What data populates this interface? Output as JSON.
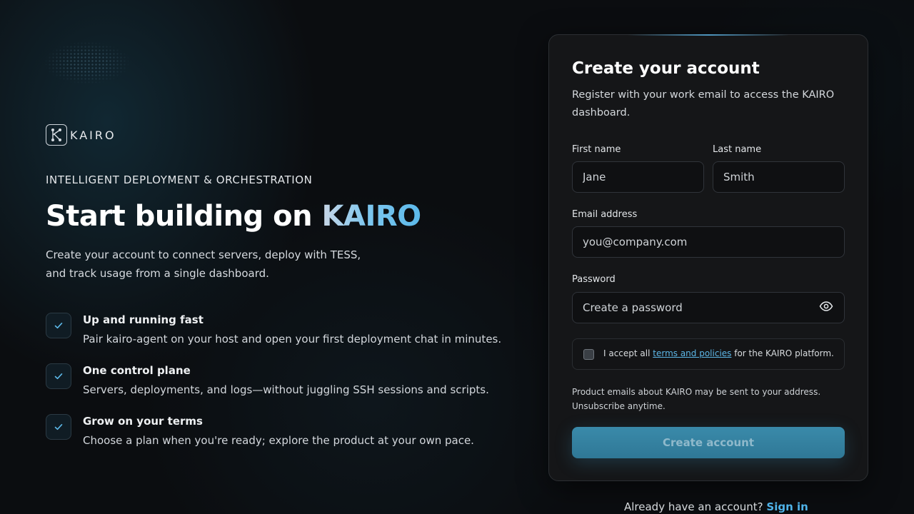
{
  "brand": {
    "name": "KAIRO",
    "icon": "kairo-logo-icon"
  },
  "hero": {
    "eyebrow": "INTELLIGENT DEPLOYMENT & ORCHESTRATION",
    "headline_prefix": "Start building on ",
    "headline_accent": "KAIRO",
    "intro": "Create your account to connect servers, deploy with TESS, and track usage from a single dashboard."
  },
  "features": [
    {
      "icon": "check-icon",
      "title": "Up and running fast",
      "desc": "Pair kairo-agent on your host and open your first deployment chat in minutes."
    },
    {
      "icon": "check-icon",
      "title": "One control plane",
      "desc": "Servers, deployments, and logs—without juggling SSH sessions and scripts."
    },
    {
      "icon": "check-icon",
      "title": "Grow on your terms",
      "desc": "Choose a plan when you're ready; explore the product at your own pace."
    }
  ],
  "form": {
    "title": "Create your account",
    "subtitle": "Register with your work email to access the KAIRO dashboard.",
    "first_name": {
      "label": "First name",
      "placeholder": "Jane",
      "value": ""
    },
    "last_name": {
      "label": "Last name",
      "placeholder": "Smith",
      "value": ""
    },
    "email": {
      "label": "Email address",
      "placeholder": "you@company.com",
      "value": ""
    },
    "password": {
      "label": "Password",
      "placeholder": "Create a password",
      "value": "",
      "toggle_icon": "eye-icon"
    },
    "terms": {
      "prefix": "I accept all ",
      "link": "terms and policies",
      "suffix": " for the KAIRO platform.",
      "checked": false
    },
    "notice": "Product emails about KAIRO may be sent to your address. Unsubscribe anytime.",
    "submit_label": "Create account"
  },
  "footer": {
    "prompt": "Already have an account? ",
    "link": "Sign in"
  },
  "colors": {
    "accent": "#4fb2e8",
    "button": "#3584a3",
    "background": "#0b0d10",
    "card": "#151618"
  }
}
